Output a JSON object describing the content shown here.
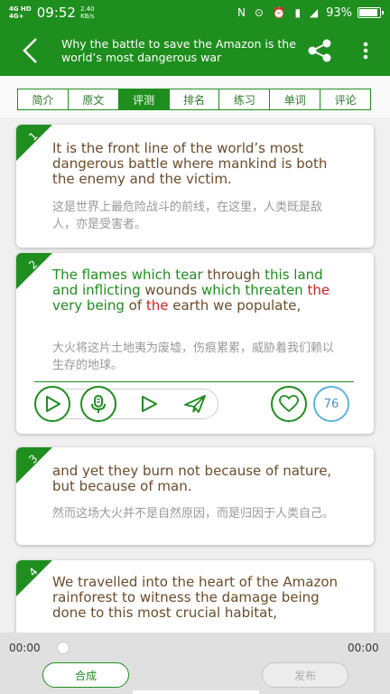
{
  "status_bar": {
    "network_top": "4G HD",
    "network_bottom": "4G+",
    "time": "09:52",
    "speed_value": "2.40",
    "speed_unit": "KB/s",
    "icons": "N ⊙ ⏰ ▮ ◢",
    "battery_percent": "93%",
    "battery_level": 0.93
  },
  "app_bar": {
    "back_icon": "back-chevron-icon",
    "title": "Why the battle to save the Amazon is the world’s most dangerous war",
    "share_icon": "share-icon",
    "more_icon": "more-vert-icon"
  },
  "tabs": [
    {
      "label": "简介"
    },
    {
      "label": "原文"
    },
    {
      "label": "评测",
      "active": true
    },
    {
      "label": "排名"
    },
    {
      "label": "练习"
    },
    {
      "label": "单词"
    },
    {
      "label": "评论"
    }
  ],
  "cards": [
    {
      "number": "1",
      "en": "It is the front line of the world’s most dangerous battle where mankind is both the enemy and the victim.",
      "zh": "这是世界上最危险战斗的前线，在这里，人类既是敌人，亦是受害者。"
    },
    {
      "number": "2",
      "en_parts": [
        {
          "text": "The flames which tear ",
          "color": "green"
        },
        {
          "text": "through ",
          "color": "brown"
        },
        {
          "text": "this ",
          "color": "green"
        },
        {
          "text": "land and inflicting ",
          "color": "green"
        },
        {
          "text": "wounds ",
          "color": "brown"
        },
        {
          "text": "which threaten ",
          "color": "green"
        },
        {
          "text": "the ",
          "color": "red"
        },
        {
          "text": "very being ",
          "color": "green"
        },
        {
          "text": "of ",
          "color": "brown"
        },
        {
          "text": "the ",
          "color": "red"
        },
        {
          "text": "earth we populate,",
          "color": "brown"
        }
      ],
      "zh": "大火将这片土地夷为废墟，伤痕累累，威胁着我们赖以生存的地球。",
      "actions": [
        "play-icon",
        "microphone-icon",
        "play-recording-icon",
        "send-icon"
      ],
      "like_icon": "heart-icon",
      "score": "76"
    },
    {
      "number": "3",
      "en": "and yet they burn not because of nature, but because of man.",
      "zh": "然而这场大火并不是自然原因，而是归因于人类自己。"
    },
    {
      "number": "4",
      "en": "We travelled into the heart of the Amazon rainforest to witness the damage being done to this most crucial habitat,"
    }
  ],
  "player": {
    "time_start": "00:00",
    "time_end": "00:00",
    "progress": 0
  },
  "buttons": {
    "compose": "合成",
    "publish": "发布"
  },
  "colors": {
    "primary_green": "#1e8e1e",
    "score_blue": "#5fb0e6",
    "highlight_red": "#d42020",
    "text_brown": "#6b4c2a"
  }
}
